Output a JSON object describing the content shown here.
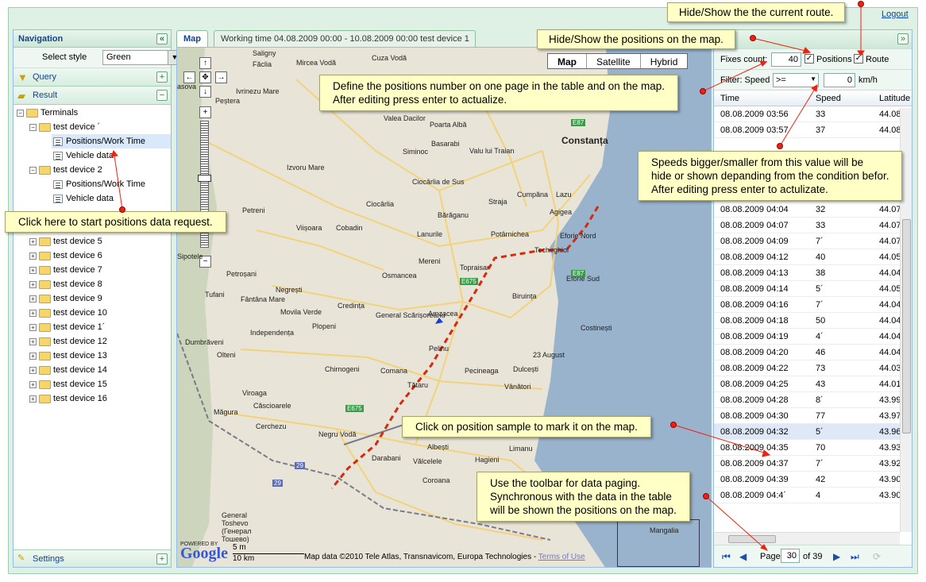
{
  "header": {
    "logout": "Logout"
  },
  "nav": {
    "title": "Navigation",
    "collapse_glyph": "«",
    "select_style_label": "Select style",
    "select_style_value": "Green",
    "query": "Query",
    "result": "Result",
    "settings": "Settings",
    "tree": {
      "root": "Terminals",
      "device1": "test device ´",
      "dev1_positions": "Positions/Work Time",
      "dev1_vehicle": "Vehicle data",
      "device2": "test device 2",
      "dev2_positions": "Positions/Work Time",
      "dev2_vehicle": "Vehicle data",
      "others": [
        "test device 5",
        "test device 6",
        "test device 7",
        "test device 8",
        "test device 9",
        "test device 10",
        "test device 1´",
        "test device 12",
        "test device 13",
        "test device 14",
        "test device 15",
        "test device 16"
      ]
    }
  },
  "tabs": {
    "map": "Map",
    "working": "Working time 04.08.2009 00:00 - 10.08.2009 00:00 test device 1"
  },
  "map": {
    "types": [
      "Map",
      "Satellite",
      "Hybrid"
    ],
    "towns": [
      "Saligny",
      "Mircea Vodă",
      "Cuza Vodă",
      "Făclia",
      "Ivrinezu Mare",
      "Peștera",
      "Valea Dacilor",
      "Poarta Albă",
      "Siminoc",
      "Basarabi",
      "Valu lui Traian",
      "Constanța",
      "Izvoru Mare",
      "Ciocârlia de Sus",
      "Ciocârlia",
      "Cumpăna",
      "Lazu",
      "Straja",
      "Bărăganu",
      "Agigea",
      "Cobadin",
      "Lanurile",
      "Potârnichea",
      "Eforie Nord",
      "Viișoara",
      "Mereni",
      "Techirghiol",
      "Topraisar",
      "Eforie Sud",
      "Petroșani",
      "Osmancea",
      "Biruința",
      "Tufani",
      "Fântâna Mare",
      "Negrești",
      "Credința",
      "Movila Verde",
      "General Scărișoreanu",
      "Amzacea",
      "Independența",
      "Plopeni",
      "Costinești",
      "Dumbrăveni",
      "Pelinu",
      "23 August",
      "Olteni",
      "Chirnogeni",
      "Comana",
      "Pecineaga",
      "Dulcești",
      "Tătaru",
      "Vânători",
      "Viroaga",
      "Căscioarele",
      "Măgura",
      "Cerchezu",
      "Negru Vodă",
      "Albești",
      "Limanu",
      "Hagieni",
      "Darabani",
      "Vălcelele",
      "Coroana",
      "Mangalia",
      "General Toshevo (Генерал Тошево)",
      "Sipotele",
      "Petreni",
      "asova"
    ],
    "roads": [
      "E87",
      "E87",
      "E675",
      "E675",
      "29",
      "29"
    ],
    "scale_top": "5 m",
    "scale_bottom": "10 km",
    "logo": "Google",
    "powered": "POWERED BY",
    "copyright": "Map data ©2010 Tele Atlas, Transnavicom, Europa Technologies -",
    "terms": "Terms of Use"
  },
  "grid": {
    "fixes_label": "Fixes count:",
    "fixes_value": "40",
    "positions_label": "Positions",
    "route_label": "Route",
    "filter_label": "Filter: Speed",
    "filter_op": ">=",
    "filter_value": "0",
    "filter_unit": "km/h",
    "collapse_glyph": "»",
    "col_time": "Time",
    "col_speed": "Speed",
    "col_lat": "Latitude",
    "rows": [
      [
        "08.08.2009 03:56",
        "33",
        "44.08"
      ],
      [
        "08.08.2009 03:57",
        "37",
        "44.08"
      ],
      [
        "",
        "",
        ""
      ],
      [
        "",
        "",
        ""
      ],
      [
        "",
        "",
        ""
      ],
      [
        "08.08.2009 04:03",
        "29",
        "44.07"
      ],
      [
        "08.08.2009 04:04",
        "32",
        "44.07"
      ],
      [
        "08.08.2009 04:07",
        "33",
        "44.07"
      ],
      [
        "08.08.2009 04:09",
        "7´",
        "44.07"
      ],
      [
        "08.08.2009 04:12",
        "40",
        "44.05"
      ],
      [
        "08.08.2009 04:13",
        "38",
        "44.04"
      ],
      [
        "08.08.2009 04:14",
        "5´",
        "44.05"
      ],
      [
        "08.08.2009 04:16",
        "7´",
        "44.04"
      ],
      [
        "08.08.2009 04:18",
        "50",
        "44.04"
      ],
      [
        "08.08.2009 04:19",
        "4´",
        "44.04"
      ],
      [
        "08.08.2009 04:20",
        "46",
        "44.04"
      ],
      [
        "08.08.2009 04:22",
        "73",
        "44.03"
      ],
      [
        "08.08.2009 04:25",
        "43",
        "44.01"
      ],
      [
        "08.08.2009 04:28",
        "8´",
        "43.99"
      ],
      [
        "08.08.2009 04:30",
        "77",
        "43.97"
      ],
      [
        "08.08.2009 04:32",
        "5´",
        "43.96"
      ],
      [
        "08.08.2009 04:35",
        "70",
        "43.93"
      ],
      [
        "08.08.2009 04:37",
        "7´",
        "43.92"
      ],
      [
        "08.08.2009 04:39",
        "42",
        "43.90"
      ],
      [
        "08.08.2009 04:4´",
        "4",
        "43.90"
      ]
    ],
    "pager": {
      "page_label": "Page",
      "page_value": "30",
      "of_label": "of 39"
    }
  },
  "callouts": {
    "route": "Hide/Show the the current route.",
    "positions": "Hide/Show the positions on the map.",
    "define": "Define the positions number on one page in the table and on the map.\nAfter editing press enter to actualize.",
    "speeds": "Speeds bigger/smaller from this value will be\nhide or shown depanding from the condition befor.\nAfter editing press enter to actulizate.",
    "click_here": "Click here to start positions data request.",
    "click_sample": "Click on position sample to mark it on the map.",
    "toolbar": "Use the toolbar for data paging.\nSynchronous with the data in the table\nwill be shown the positions on the map."
  },
  "colors": {
    "panel_bg": "#dff0e5",
    "callout_bg": "#ffffc6",
    "route": "#d42a0e",
    "accent": "#15428b"
  }
}
